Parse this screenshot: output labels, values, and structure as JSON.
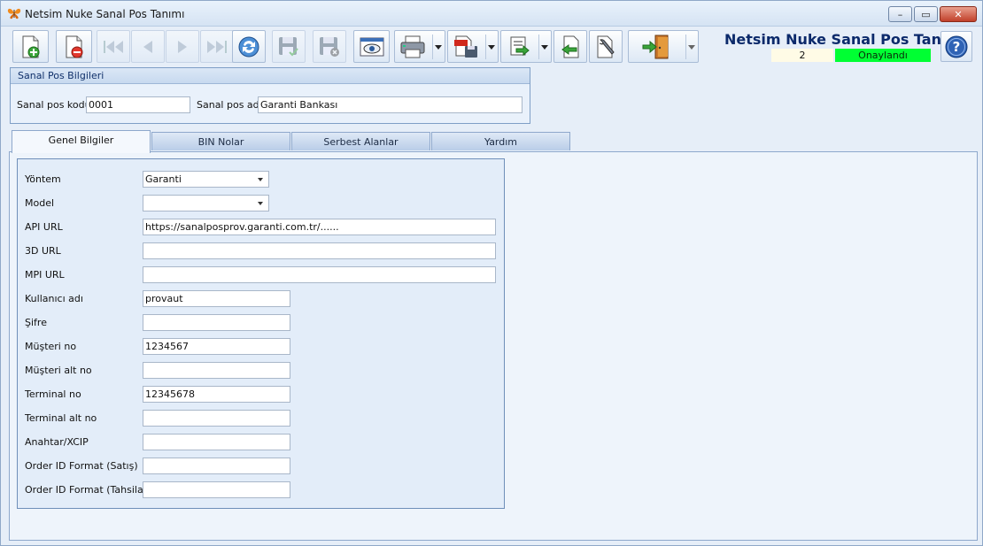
{
  "window": {
    "title": "Netsim Nuke Sanal Pos Tanımı",
    "controls": {
      "minimize": "–",
      "maximize": "▭",
      "close": "✕"
    }
  },
  "toolbar": {
    "buttons": [
      {
        "name": "new-record-button",
        "icon": "new-document-plus-icon"
      },
      {
        "name": "delete-record-button",
        "icon": "delete-document-icon"
      },
      {
        "name": "first-record-button",
        "icon": "first-icon",
        "disabled": true
      },
      {
        "name": "previous-record-button",
        "icon": "previous-icon",
        "disabled": true
      },
      {
        "name": "next-record-button",
        "icon": "next-icon",
        "disabled": true
      },
      {
        "name": "last-record-button",
        "icon": "last-icon",
        "disabled": true
      },
      {
        "name": "refresh-button",
        "icon": "refresh-icon"
      },
      {
        "name": "save-button",
        "icon": "save-check-icon",
        "disabled": true
      },
      {
        "name": "cancel-save-button",
        "icon": "save-cancel-icon",
        "disabled": true
      },
      {
        "name": "preview-button",
        "icon": "preview-eye-icon"
      },
      {
        "name": "print-button",
        "icon": "printer-icon"
      },
      {
        "name": "pdf-export-button",
        "icon": "pdf-save-icon"
      },
      {
        "name": "export-button",
        "icon": "export-icon"
      },
      {
        "name": "import-button",
        "icon": "import-icon"
      },
      {
        "name": "settings-button",
        "icon": "wrench-document-icon"
      },
      {
        "name": "exit-button",
        "icon": "exit-door-icon"
      }
    ]
  },
  "header": {
    "title": "Netsim Nuke Sanal Pos Tanımı",
    "record_count": "2",
    "status": "Onaylandı",
    "status_color": "#00ff33"
  },
  "pos_info": {
    "group_title": "Sanal Pos Bilgileri",
    "code_label": "Sanal pos kodu",
    "code_value": "0001",
    "name_label": "Sanal pos adı",
    "name_value": "Garanti Bankası"
  },
  "tabs": [
    {
      "label": "Genel Bilgiler",
      "active": true
    },
    {
      "label": "BIN Nolar",
      "active": false
    },
    {
      "label": "Serbest Alanlar",
      "active": false
    },
    {
      "label": "Yardım",
      "active": false
    }
  ],
  "form": {
    "yontem": {
      "label": "Yöntem",
      "value": "Garanti"
    },
    "model": {
      "label": "Model",
      "value": ""
    },
    "api_url": {
      "label": "API URL",
      "value": "https://sanalposprov.garanti.com.tr/......"
    },
    "url_3d": {
      "label": "3D URL",
      "value": ""
    },
    "mpi_url": {
      "label": "MPI URL",
      "value": ""
    },
    "kullanici_adi": {
      "label": "Kullanıcı adı",
      "value": "provaut"
    },
    "sifre": {
      "label": "Şifre",
      "value": ""
    },
    "musteri_no": {
      "label": "Müşteri no",
      "value": "1234567"
    },
    "musteri_alt_no": {
      "label": "Müşteri alt no",
      "value": ""
    },
    "terminal_no": {
      "label": "Terminal no",
      "value": "12345678"
    },
    "terminal_alt_no": {
      "label": "Terminal alt no",
      "value": ""
    },
    "anahtar": {
      "label": "Anahtar/XCIP",
      "value": ""
    },
    "order_id_satis": {
      "label": "Order ID Format (Satış)",
      "value": ""
    },
    "order_id_tahsilat": {
      "label": "Order ID Format (Tahsilat)",
      "value": ""
    }
  }
}
